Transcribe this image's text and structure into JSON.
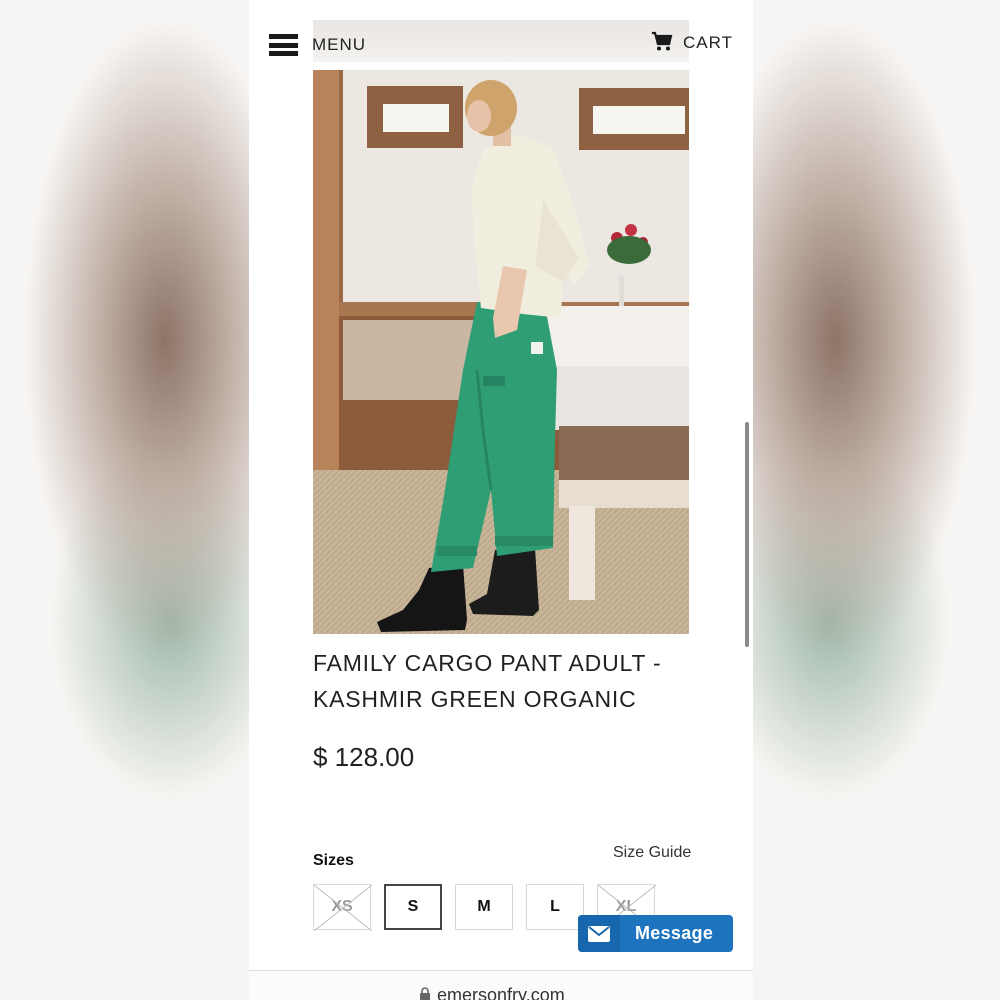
{
  "header": {
    "menu_label": "MENU",
    "cart_label": "CART"
  },
  "product": {
    "title_line1": "FAMILY CARGO PANT ADULT -",
    "title_line2": "KASHMIR GREEN ORGANIC",
    "price": "$ 128.00",
    "image_alt": "Model wearing green cargo pants, cream sweater and black boots"
  },
  "sizes": {
    "label": "Sizes",
    "guide_label": "Size Guide",
    "options": [
      {
        "label": "XS",
        "available": false,
        "selected": false
      },
      {
        "label": "S",
        "available": true,
        "selected": true
      },
      {
        "label": "M",
        "available": true,
        "selected": false
      },
      {
        "label": "L",
        "available": true,
        "selected": false
      },
      {
        "label": "XL",
        "available": false,
        "selected": false
      }
    ]
  },
  "chat": {
    "button_label": "Message"
  },
  "browser": {
    "url": "emersonfry.com"
  },
  "colors": {
    "accent": "#1e73be",
    "pant_green": "#2f9e74"
  }
}
